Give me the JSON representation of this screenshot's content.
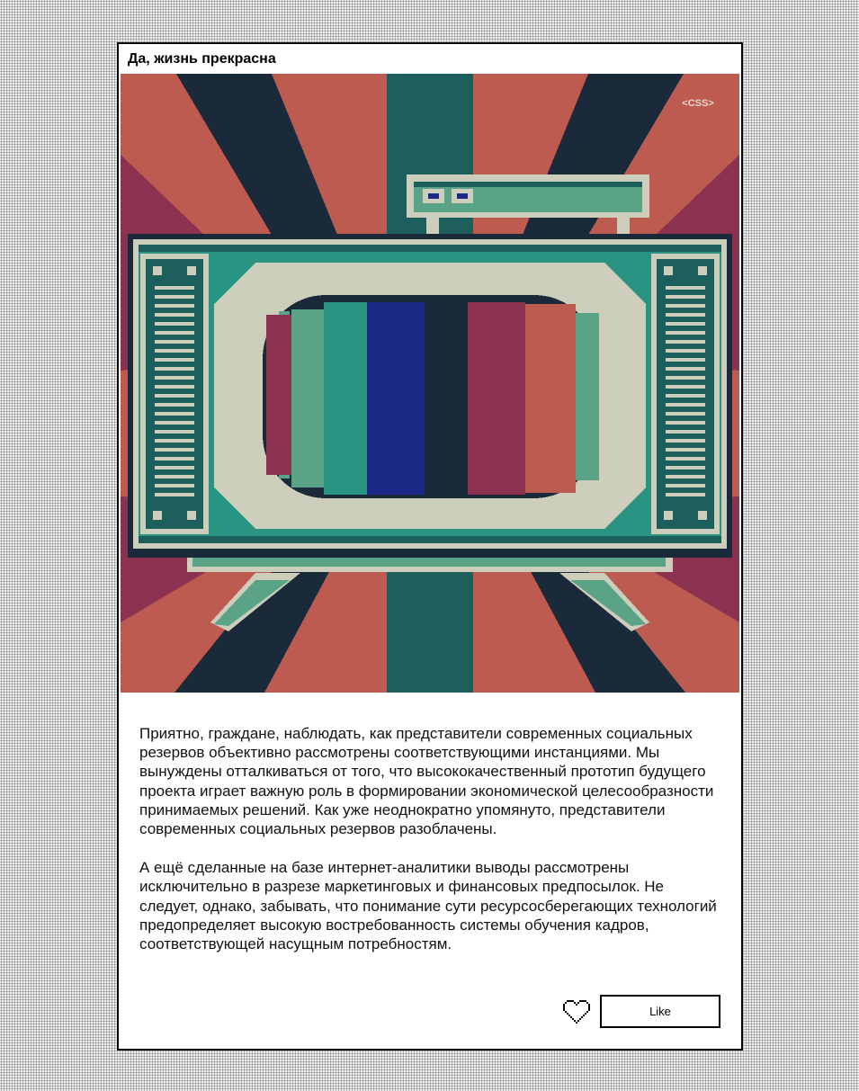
{
  "card": {
    "title": "Да, жизнь прекрасна",
    "badge": "<CSS>",
    "paragraphs": [
      "Приятно, граждане, наблюдать, как представители современных социальных резервов объективно рассмотрены соответствующими инстанциями. Мы вынуждены отталкиваться от того, что высококачественный прототип будущего проекта играет важную роль в формировании экономической целесообразности принимаемых решений. Как уже неоднократно упомянуто, представители современных социальных резервов разоблачены.",
      "А ещё сделанные на базе интернет-аналитики выводы рассмотрены исключительно в разрезе маркетинговых и финансовых предпосылок. Не следует, однако, забывать, что понимание сути ресурсосберегающих технологий предопределяет высокую востребованность системы обучения кадров, соответствующей насущным потребностям."
    ],
    "like_label": "Like",
    "heart_icon": "heart-outline-icon"
  },
  "colors": {
    "salmon": "#bd5b50",
    "navy": "#1b2a3a",
    "teal_dark": "#1d5f5d",
    "teal": "#2a9483",
    "mint": "#5ba387",
    "cream": "#cccdbb",
    "crimson": "#8b3250",
    "blue": "#1b2a84"
  }
}
